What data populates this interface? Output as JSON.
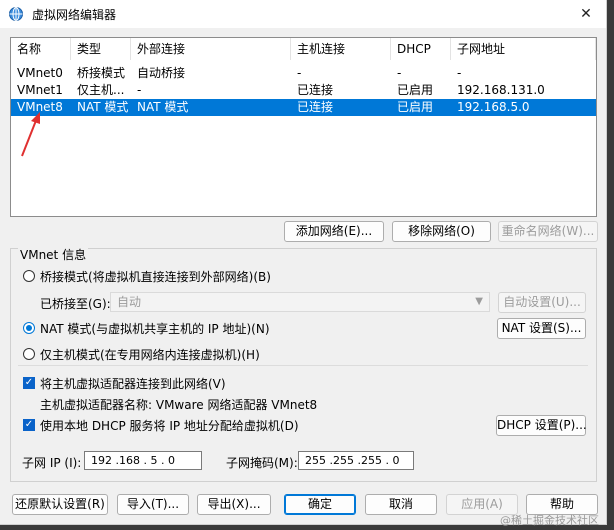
{
  "window": {
    "title": "虚拟网络编辑器",
    "icon": "vmware-network-icon",
    "close": "✕"
  },
  "list": {
    "columns": [
      "名称",
      "类型",
      "外部连接",
      "主机连接",
      "DHCP",
      "子网地址"
    ],
    "rows": [
      {
        "name": "VMnet0",
        "type": "桥接模式",
        "external": "自动桥接",
        "host": "-",
        "dhcp": "-",
        "subnet": "-"
      },
      {
        "name": "VMnet1",
        "type": "仅主机...",
        "external": "-",
        "host": "已连接",
        "dhcp": "已启用",
        "subnet": "192.168.131.0"
      },
      {
        "name": "VMnet8",
        "type": "NAT 模式",
        "external": "NAT 模式",
        "host": "已连接",
        "dhcp": "已启用",
        "subnet": "192.168.5.0"
      }
    ],
    "selected_index": 2
  },
  "list_buttons": {
    "add": "添加网络(E)...",
    "remove": "移除网络(O)",
    "rename": "重命名网络(W)..."
  },
  "vmnet_info": {
    "title": "VMnet 信息",
    "bridged_label": "桥接模式(将虚拟机直接连接到外部网络)(B)",
    "bridged_to_label": "已桥接至(G):",
    "bridged_to_value": "自动",
    "auto_settings": "自动设置(U)...",
    "nat_label": "NAT 模式(与虚拟机共享主机的 IP 地址)(N)",
    "nat_settings": "NAT 设置(S)...",
    "hostonly_label": "仅主机模式(在专用网络内连接虚拟机)(H)",
    "connect_adapter_label": "将主机虚拟适配器连接到此网络(V)",
    "adapter_name_label": "主机虚拟适配器名称: VMware 网络适配器 VMnet8",
    "dhcp_label": "使用本地 DHCP 服务将 IP 地址分配给虚拟机(D)",
    "dhcp_settings": "DHCP 设置(P)...",
    "subnet_ip_label": "子网 IP (I):",
    "subnet_ip_value": "192 .168 . 5 . 0",
    "subnet_mask_label": "子网掩码(M):",
    "subnet_mask_value": "255 .255 .255 . 0",
    "selected_mode": "nat",
    "connect_adapter_checked": true,
    "dhcp_checked": true
  },
  "footer_buttons": {
    "restore": "还原默认设置(R)",
    "import": "导入(T)...",
    "export": "导出(X)...",
    "ok": "确定",
    "cancel": "取消",
    "apply": "应用(A)",
    "help": "帮助"
  },
  "watermark": "@稀土掘金技术社区",
  "colors": {
    "selection": "#0078d7",
    "arrow": "#e03030",
    "checkbox": "#0a63c9"
  }
}
